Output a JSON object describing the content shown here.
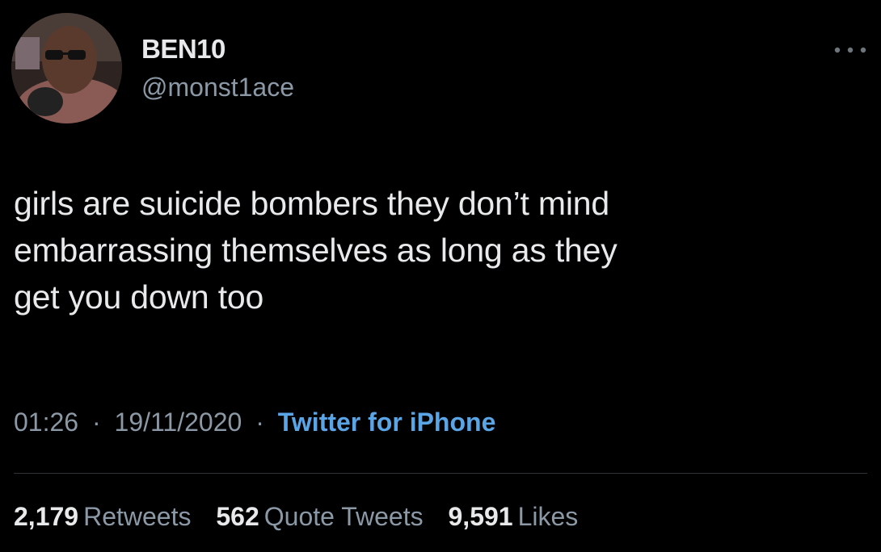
{
  "user": {
    "display_name": "BEN10",
    "handle": "@monst1ace"
  },
  "tweet": {
    "text": "girls are suicide bombers they don’t mind\nembarrassing themselves as long as they\nget you down too",
    "time": "01:26",
    "date": "19/11/2020",
    "separator": "·",
    "client": "Twitter for iPhone"
  },
  "stats": {
    "retweets_count": "2,179",
    "retweets_label": "Retweets",
    "quotes_count": "562",
    "quotes_label": "Quote Tweets",
    "likes_count": "9,591",
    "likes_label": "Likes"
  },
  "icons": {
    "more": "more-options-icon",
    "avatar": "avatar"
  },
  "colors": {
    "background": "#000000",
    "text": "#e7e9ea",
    "secondary": "#8b98a5",
    "link": "#5aa5e6"
  }
}
